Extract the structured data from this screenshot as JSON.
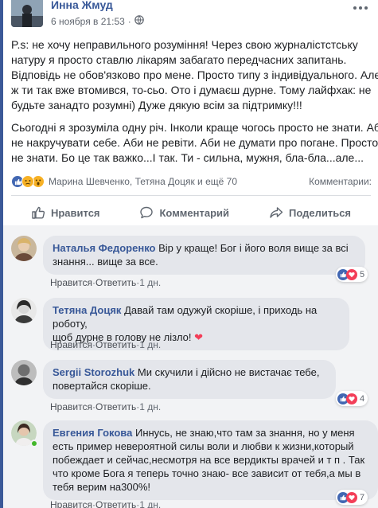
{
  "post": {
    "author": "Инна Жмуд",
    "timestamp": "6 ноября в 21:53",
    "privacy_icon": "globe-icon",
    "paragraphs": [
      [
        "P.s: не хочу неправильного розуміння! Через свою журналістстську",
        "натуру я просто ставлю лікарям забагато передчасних запитань.",
        "Відповідь не обов'язково про мене. Просто типу з індивідуального. Але",
        "ж ти так вже втомився, то-сьо. Ото і думаєш дурне. Тому лайфхак: не",
        "будьте занадто розумні) Дуже дякую всім за підтримку!!!"
      ],
      [
        "Сьогодні я зрозуміла одну річ. Інколи краще чогось просто не знати. Аби",
        "не накручувати себе. Аби не ревіти. Аби не думати про погане. Просто",
        "не знати. Бо це так важко...І так. Ти - сильна, мужня, бла-бла...але..."
      ]
    ],
    "reactions": {
      "names": "Марина Шевченко, Тетяна Доцяк и ещё 70",
      "comments_label": "Комментарии: ",
      "icons": [
        "like-icon",
        "sad-icon",
        "wow-icon"
      ]
    },
    "actions": {
      "like": "Нравится",
      "comment": "Комментарий",
      "share": "Поделиться"
    }
  },
  "comments": [
    {
      "name": "Наталья Федоренко",
      "lines": [
        "Вір у краще! Бог і його воля вище за всі",
        "знання... вище за все."
      ],
      "like": "Нравится",
      "reply": "Ответить",
      "time": "1 дн.",
      "reaction_count": "5",
      "reaction_icons": [
        "like-icon",
        "love-icon"
      ]
    },
    {
      "name": "Тетяна Доцяк",
      "lines": [
        "Давай там одужуй скоріше, і приходь на роботу,",
        "щоб дурне в голову не лізло! "
      ],
      "heart_emoji": "❤",
      "like": "Нравится",
      "reply": "Ответить",
      "time": "1 дн.",
      "reaction_count": "",
      "reaction_icons": []
    },
    {
      "name": "Sergii Storozhuk",
      "lines": [
        "Ми скучили і дійсно не вистачає тебе,",
        "повертайся скоріше."
      ],
      "like": "Нравится",
      "reply": "Ответить",
      "time": "1 дн.",
      "reaction_count": "4",
      "reaction_icons": [
        "like-icon",
        "love-icon"
      ]
    },
    {
      "name": "Евгения Гокова",
      "lines": [
        "Иннусь, не знаю,что там за знання, но у меня",
        "есть пример невероятной силы воли и любви к жизни,который",
        "побеждает и сейчас,несмотря на все вердикты врачей и т п . Так",
        "что кроме Бога я теперь точно знаю- все зависит от тебя,а мы в",
        "тебя верим на300%!"
      ],
      "like": "Нравится",
      "reply": "Ответить",
      "time": "1 дн.",
      "reaction_count": "7",
      "reaction_icons": [
        "like-icon",
        "love-icon"
      ]
    }
  ],
  "separator": " · ",
  "colors": {
    "link_blue": "#385898",
    "facebook_blue": "#4267b2",
    "love_red": "#f33e58",
    "wow_yellow": "#f7b125",
    "muted_text": "#616770",
    "comment_bg": "#f2f3f5",
    "bubble_bg": "#e4e6eb",
    "online_green": "#42b72a"
  }
}
